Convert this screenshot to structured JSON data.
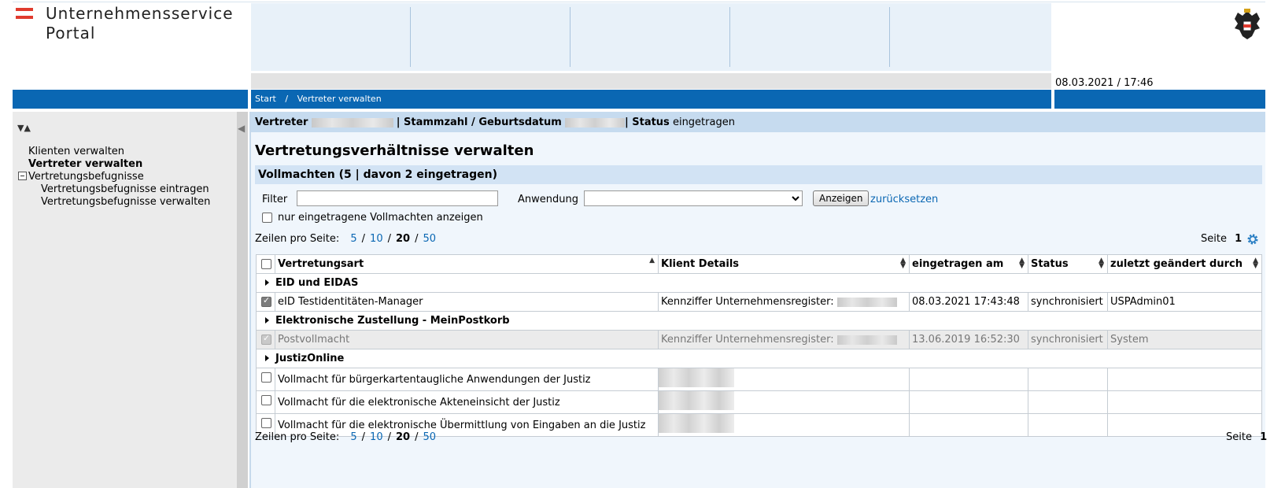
{
  "header": {
    "brand_line1": "Unternehmensservice",
    "brand_line2": "Portal",
    "datetime": "08.03.2021 / 17:46",
    "logo_icon": "austria-flag-logo",
    "emblem_icon": "austrian-eagle-emblem"
  },
  "breadcrumb": {
    "items": [
      "Start",
      "Vertreter verwalten"
    ],
    "separator": "/"
  },
  "sidebar": {
    "items": [
      {
        "label": "Klienten verwalten",
        "active": false
      },
      {
        "label": "Vertreter verwalten",
        "active": true
      },
      {
        "label": "Vertretungsbefugnisse",
        "active": false
      },
      {
        "label": "Vertretungsbefugnisse eintragen",
        "active": false
      },
      {
        "label": "Vertretungsbefugnisse verwalten",
        "active": false
      }
    ]
  },
  "vertreter_bar": {
    "vertreter_label": "Vertreter",
    "stammzahl_label": "| Stammzahl / Geburtsdatum",
    "status_label": "| Status",
    "status_value": "eingetragen"
  },
  "main": {
    "title": "Vertretungsverhältnisse verwalten",
    "section_title": "Vollmachten (5 | davon 2 eingetragen)",
    "filter_label": "Filter",
    "filter_value": "",
    "anwendung_label": "Anwendung",
    "anwendung_value": "",
    "anzeigen_button": "Anzeigen",
    "reset_link": "zurücksetzen",
    "only_registered_label": "nur eingetragene Vollmachten anzeigen",
    "only_registered_checked": false,
    "page_label": "Seite",
    "page_number": "1"
  },
  "pager": {
    "label": "Zeilen pro Seite:",
    "options": [
      "5",
      "10",
      "20",
      "50"
    ],
    "current": "20",
    "separator": "/"
  },
  "table": {
    "columns": [
      "Vertretungsart",
      "Klient Details",
      "eingetragen am",
      "Status",
      "zuletzt geändert durch"
    ],
    "groups": [
      {
        "name": "EID und EIDAS",
        "rows": [
          {
            "checked": true,
            "disabled": false,
            "art": "eID Testidentitäten-Manager",
            "klient": "Kennziffer Unternehmensregister:",
            "eingetragen": "08.03.2021 17:43:48",
            "status": "synchronisiert",
            "geaendert": "USPAdmin01"
          }
        ]
      },
      {
        "name": "Elektronische Zustellung - MeinPostkorb",
        "rows": [
          {
            "checked": true,
            "disabled": true,
            "art": "Postvollmacht",
            "klient": "Kennziffer Unternehmensregister:",
            "eingetragen": "13.06.2019 16:52:30",
            "status": "synchronisiert",
            "geaendert": "System"
          }
        ]
      },
      {
        "name": "JustizOnline",
        "rows": [
          {
            "checked": false,
            "disabled": false,
            "art": "Vollmacht für bürgerkartentaugliche Anwendungen der Justiz",
            "klient": "",
            "eingetragen": "",
            "status": "",
            "geaendert": ""
          },
          {
            "checked": false,
            "disabled": false,
            "art": "Vollmacht für die elektronische Akteneinsicht der Justiz",
            "klient": "",
            "eingetragen": "",
            "status": "",
            "geaendert": ""
          },
          {
            "checked": false,
            "disabled": false,
            "art": "Vollmacht für die elektronische Übermittlung von Eingaben an die Justiz",
            "klient": "",
            "eingetragen": "",
            "status": "",
            "geaendert": ""
          }
        ]
      }
    ]
  },
  "colors": {
    "primary_blue": "#0a67b3",
    "light_blue": "#e8f1f9",
    "flag_red": "#e03b2e",
    "sidebar_gray": "#ebebeb"
  }
}
